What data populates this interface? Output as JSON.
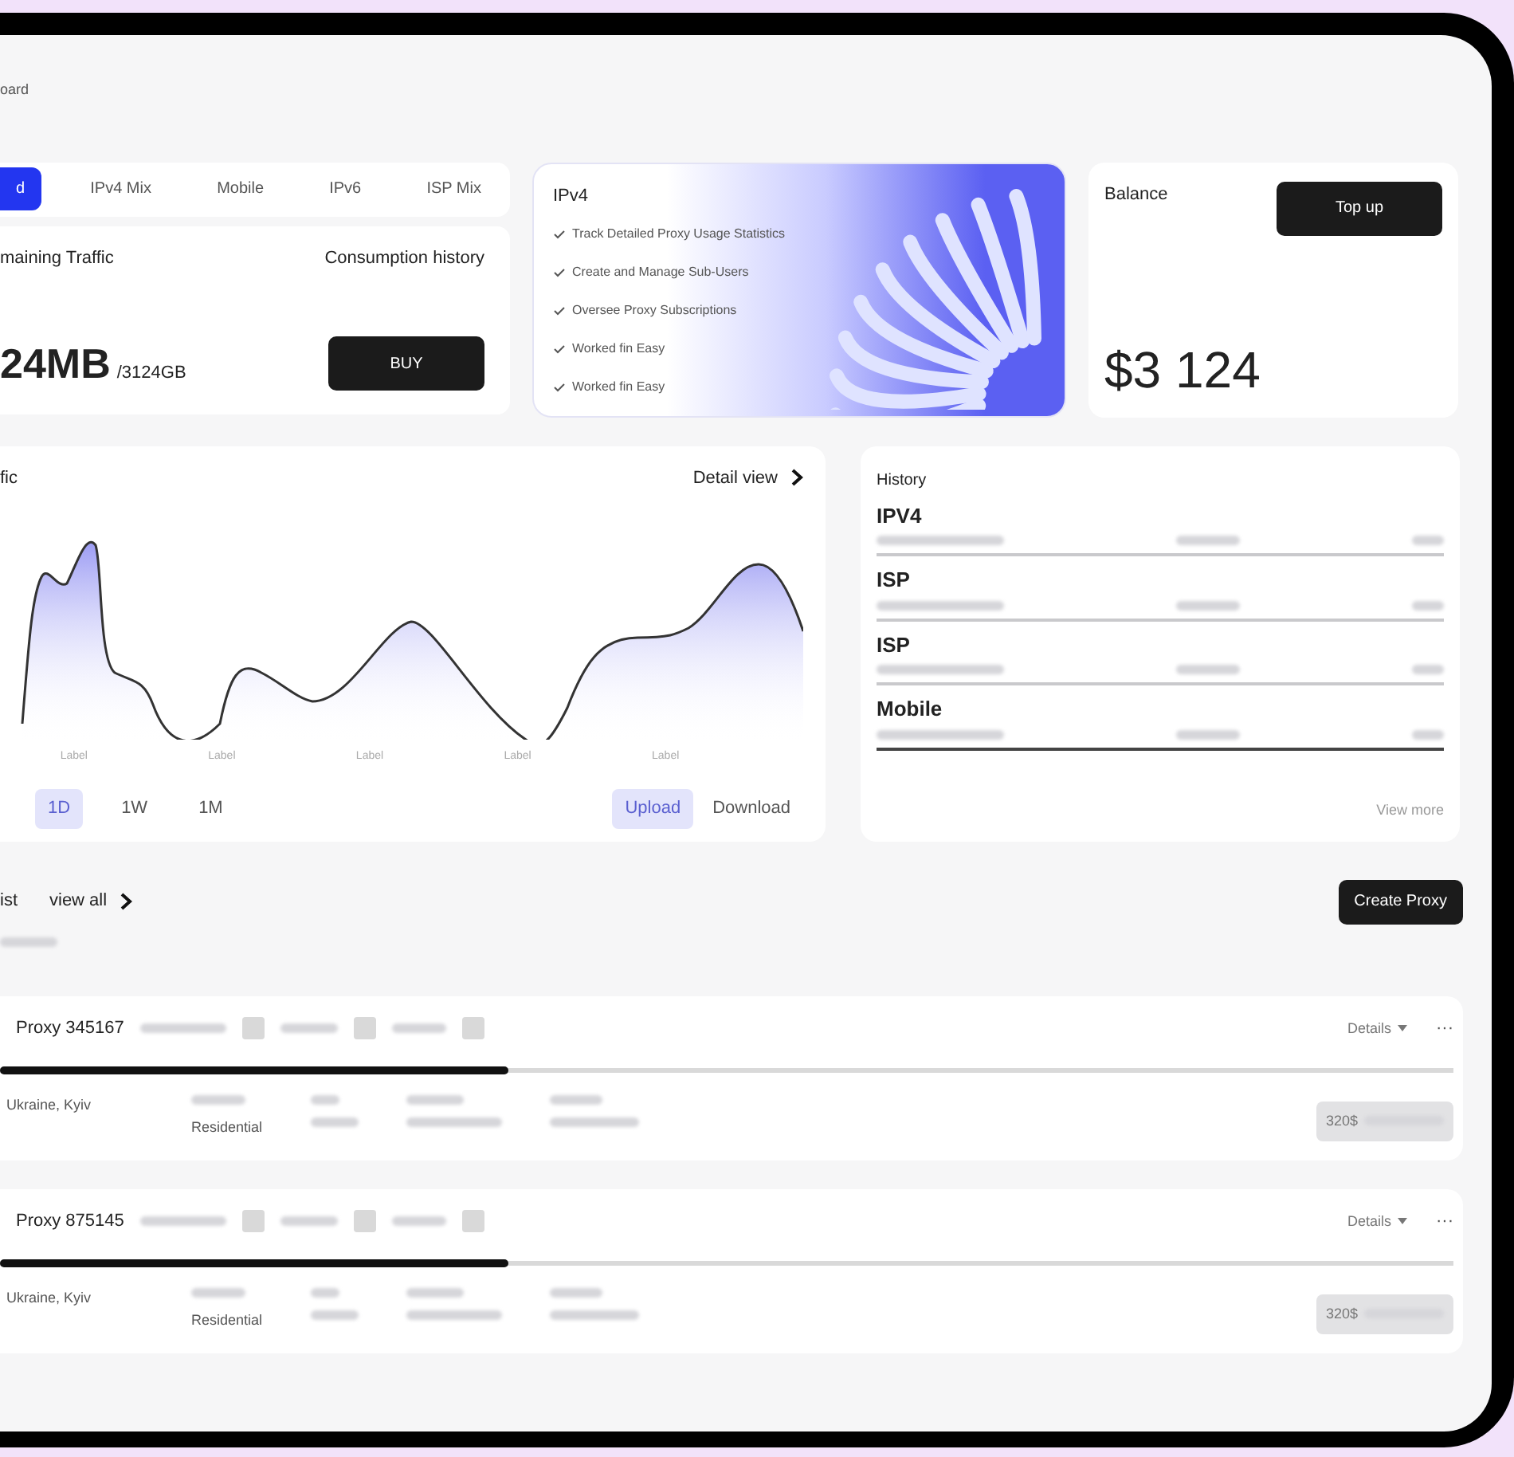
{
  "breadcrumb": "oard",
  "product_tabs": [
    {
      "label": "d",
      "selected": true
    },
    {
      "label": "IPv4 Mix",
      "selected": false
    },
    {
      "label": "Mobile",
      "selected": false
    },
    {
      "label": "IPv6",
      "selected": false
    },
    {
      "label": "ISP Mix",
      "selected": false
    }
  ],
  "traffic": {
    "label": "maining Traffic",
    "history_link": "Consumption history",
    "used": "24MB",
    "total": "/3124GB",
    "buy": "BUY"
  },
  "plan": {
    "title": "IPv4",
    "features": [
      "Track Detailed Proxy Usage Statistics",
      "Create and Manage Sub-Users",
      "Oversee Proxy Subscriptions",
      "Worked fin Easy",
      "Worked fin Easy"
    ]
  },
  "balance": {
    "label": "Balance",
    "top_up": "Top up",
    "amount": "$3 124"
  },
  "traffic_chart": {
    "title": "fic",
    "detail": "Detail view",
    "x_labels": [
      "Label",
      "Label",
      "Label",
      "Label",
      "Label"
    ],
    "periods": [
      {
        "label": "1D",
        "selected": true
      },
      {
        "label": "1W",
        "selected": false
      },
      {
        "label": "1M",
        "selected": false
      }
    ],
    "directions": [
      {
        "label": "Upload",
        "selected": true
      },
      {
        "label": "Download",
        "selected": false
      }
    ]
  },
  "history": {
    "title": "History",
    "items": [
      {
        "type": "IPV4"
      },
      {
        "type": "ISP"
      },
      {
        "type": "ISP"
      },
      {
        "type": "Mobile"
      }
    ],
    "view_more": "View more"
  },
  "proxy_list": {
    "title": "ist",
    "view_all": "view all",
    "create": "Create Proxy",
    "proxies": [
      {
        "name": "Proxy 345167",
        "details": "Details",
        "menu": "···",
        "level": 0.35,
        "location": "Ukraine, Kyiv",
        "network": "Residential",
        "price": "320$"
      },
      {
        "name": "Proxy 875145",
        "details": "Details",
        "menu": "···",
        "level": 0.35,
        "location": "Ukraine, Kyiv",
        "network": "Residential",
        "price": "320$"
      }
    ]
  }
}
